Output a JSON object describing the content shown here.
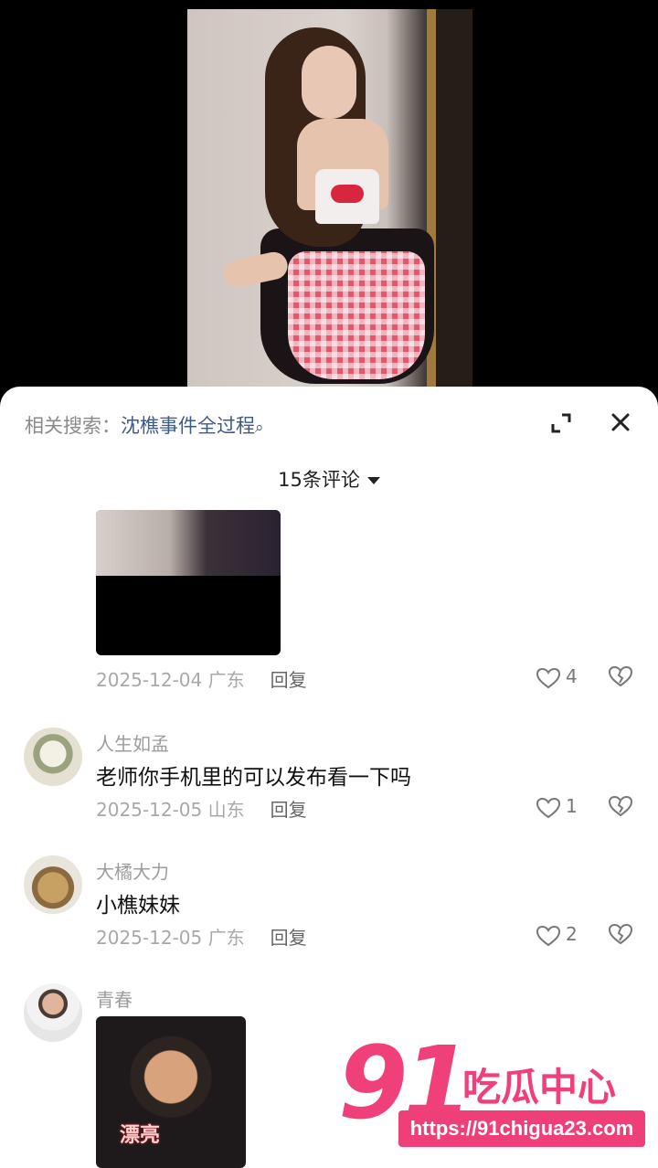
{
  "header": {
    "related_prefix": "相关搜索：",
    "related_term": "沈樵事件全过程",
    "search_glyph": "🔍"
  },
  "comments_count": "15条评论",
  "comments": [
    {
      "date": "2025-12-04 广东",
      "reply": "回复",
      "likes": "4"
    },
    {
      "username": "人生如孟",
      "text": "老师你手机里的可以发布看一下吗",
      "date": "2025-12-05 山东",
      "reply": "回复",
      "likes": "1"
    },
    {
      "username": "大橘大力",
      "text": "小樵妹妹",
      "date": "2025-12-05 广东",
      "reply": "回复",
      "likes": "2"
    },
    {
      "username": "青春",
      "gif_caption": "漂亮"
    }
  ],
  "watermark": {
    "number": "91",
    "name": "吃瓜中心",
    "url": "https://91chigua23.com"
  },
  "icons": [
    "expand-icon",
    "close-icon",
    "caret-down-icon",
    "heart-icon",
    "dislike-icon"
  ],
  "colors": {
    "accent": "#f0407a",
    "link": "#3d5a8c"
  }
}
